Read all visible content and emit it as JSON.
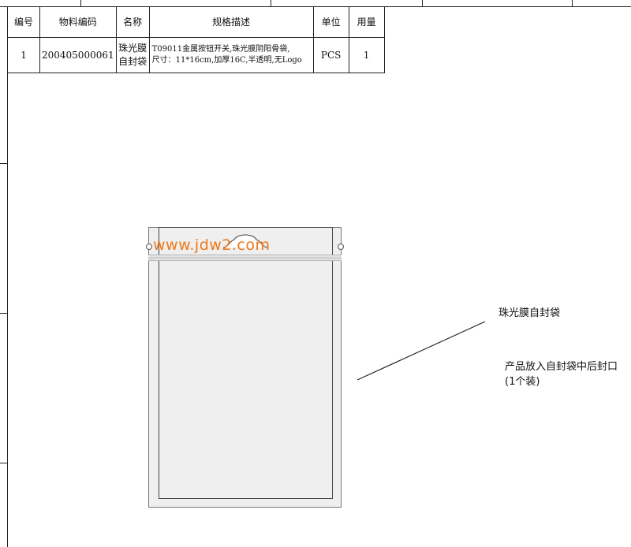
{
  "table": {
    "headers": [
      "编号",
      "物料编码",
      "名称",
      "规格描述",
      "单位",
      "用量"
    ],
    "rows": [
      {
        "no": "1",
        "code": "200405000061",
        "name_line1": "珠光膜",
        "name_line2": "自封袋",
        "desc_line1": "T09011金属按钮开关,珠光膜阴阳骨袋,",
        "desc_line2": "尺寸：11*16cm,加厚16C,半透明,无Logo",
        "unit": "PCS",
        "qty": "1"
      }
    ]
  },
  "drawing": {
    "watermark": "www.jdw2.com",
    "watermark_color": "#f07818",
    "callout_label": "珠光膜自封袋",
    "note_line1": "产品放入自封袋中后封口",
    "note_line2": "(1个装)"
  }
}
